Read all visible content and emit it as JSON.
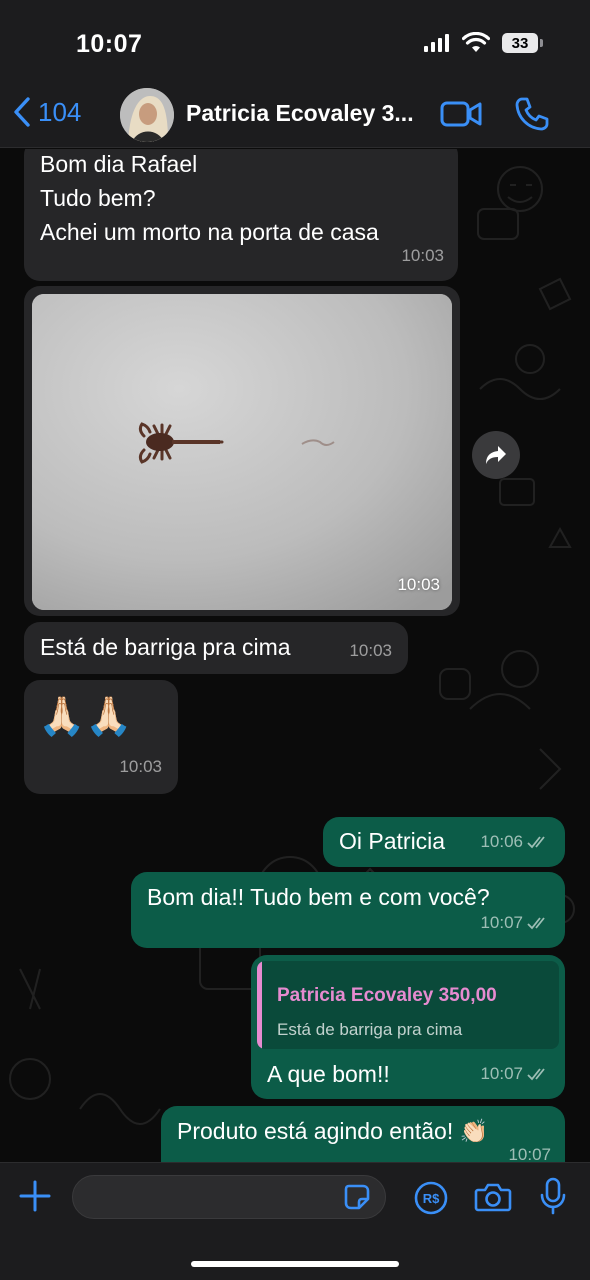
{
  "status_bar": {
    "time": "10:07",
    "battery": "33"
  },
  "header": {
    "back_count": "104",
    "contact_name": "Patricia Ecovaley 3..."
  },
  "messages": [
    {
      "direction": "in",
      "lines": [
        "Bom dia Rafael",
        "Tudo bem?",
        "Achei um morto na porta de casa"
      ],
      "time": "10:03"
    },
    {
      "direction": "in",
      "type": "image",
      "time": "10:03"
    },
    {
      "direction": "in",
      "text": "Está de barriga pra cima",
      "time": "10:03"
    },
    {
      "direction": "in",
      "text": "🙏🏻🙏🏻",
      "time": "10:03"
    },
    {
      "direction": "out",
      "text": "Oi Patricia",
      "time": "10:06"
    },
    {
      "direction": "out",
      "text": "Bom dia!! Tudo bem e com você?",
      "time": "10:07"
    },
    {
      "direction": "out",
      "quote_name": "Patricia Ecovaley 350,00",
      "quote_text": "Está de barriga pra cima",
      "text": "A que bom!!",
      "time": "10:07"
    },
    {
      "direction": "out",
      "text": "Produto está agindo então! 👏🏻",
      "time": "10:07"
    }
  ],
  "input": {
    "placeholder": ""
  },
  "colors": {
    "accent": "#3a8ff7",
    "outgoing_bubble": "#0c5c48",
    "incoming_bubble": "#262628",
    "quote_name": "#e68bd0"
  },
  "icons": [
    "back-chevron-icon",
    "video-call-icon",
    "phone-icon",
    "forward-icon",
    "read-ticks-icon",
    "plus-icon",
    "sticker-icon",
    "payment-icon",
    "camera-icon",
    "mic-icon"
  ]
}
